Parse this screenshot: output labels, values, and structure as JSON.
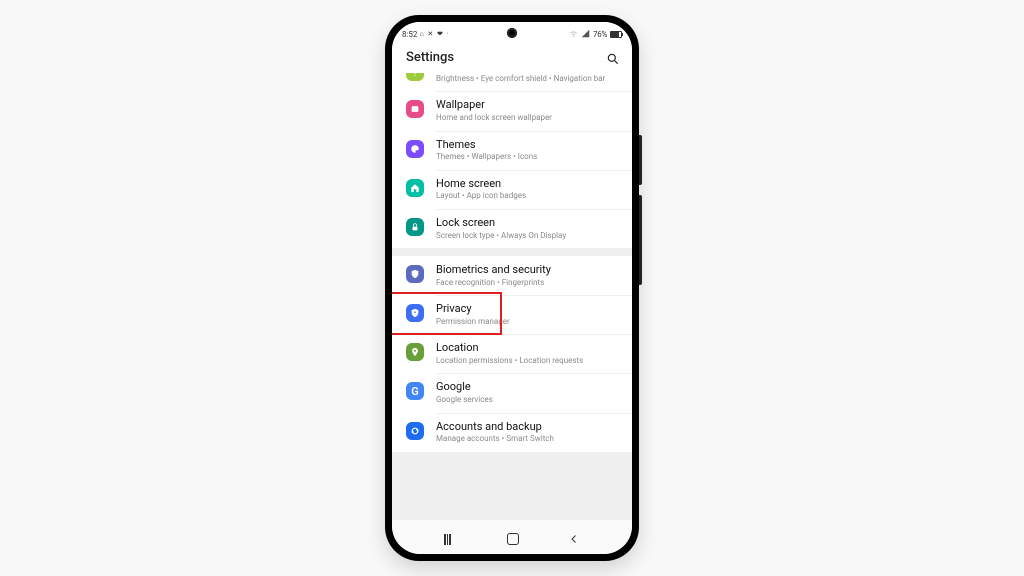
{
  "statusbar": {
    "time": "8:52",
    "indicators": "⌂ ✕ ❤ ·",
    "battery_text": "76%"
  },
  "header": {
    "title": "Settings"
  },
  "groups": [
    {
      "rows": [
        {
          "id": "display",
          "icon": "sun",
          "color": "ic-green",
          "label": "",
          "sub": "Brightness  •  Eye comfort shield  •  Navigation bar",
          "partial": true
        },
        {
          "id": "wallpaper",
          "icon": "image",
          "color": "ic-pink",
          "label": "Wallpaper",
          "sub": "Home and lock screen wallpaper"
        },
        {
          "id": "themes",
          "icon": "palette",
          "color": "ic-purple",
          "label": "Themes",
          "sub": "Themes  •  Wallpapers  •  Icons"
        },
        {
          "id": "homescreen",
          "icon": "home",
          "color": "ic-teal",
          "label": "Home screen",
          "sub": "Layout  •  App icon badges"
        },
        {
          "id": "lockscreen",
          "icon": "lock",
          "color": "ic-teal2",
          "label": "Lock screen",
          "sub": "Screen lock type  •  Always On Display"
        }
      ]
    },
    {
      "rows": [
        {
          "id": "biometrics",
          "icon": "shield",
          "color": "ic-indigo",
          "label": "Biometrics and security",
          "sub": "Face recognition  •  Fingerprints"
        },
        {
          "id": "privacy",
          "icon": "privacy",
          "color": "ic-blue",
          "label": "Privacy",
          "sub": "Permission manager",
          "highlighted": true
        },
        {
          "id": "location",
          "icon": "pin",
          "color": "ic-olive",
          "label": "Location",
          "sub": "Location permissions  •  Location requests"
        },
        {
          "id": "google",
          "icon": "g",
          "color": "ic-gblue",
          "label": "Google",
          "sub": "Google services"
        },
        {
          "id": "accounts",
          "icon": "sync",
          "color": "ic-blue2",
          "label": "Accounts and backup",
          "sub": "Manage accounts  •  Smart Switch"
        }
      ]
    }
  ]
}
